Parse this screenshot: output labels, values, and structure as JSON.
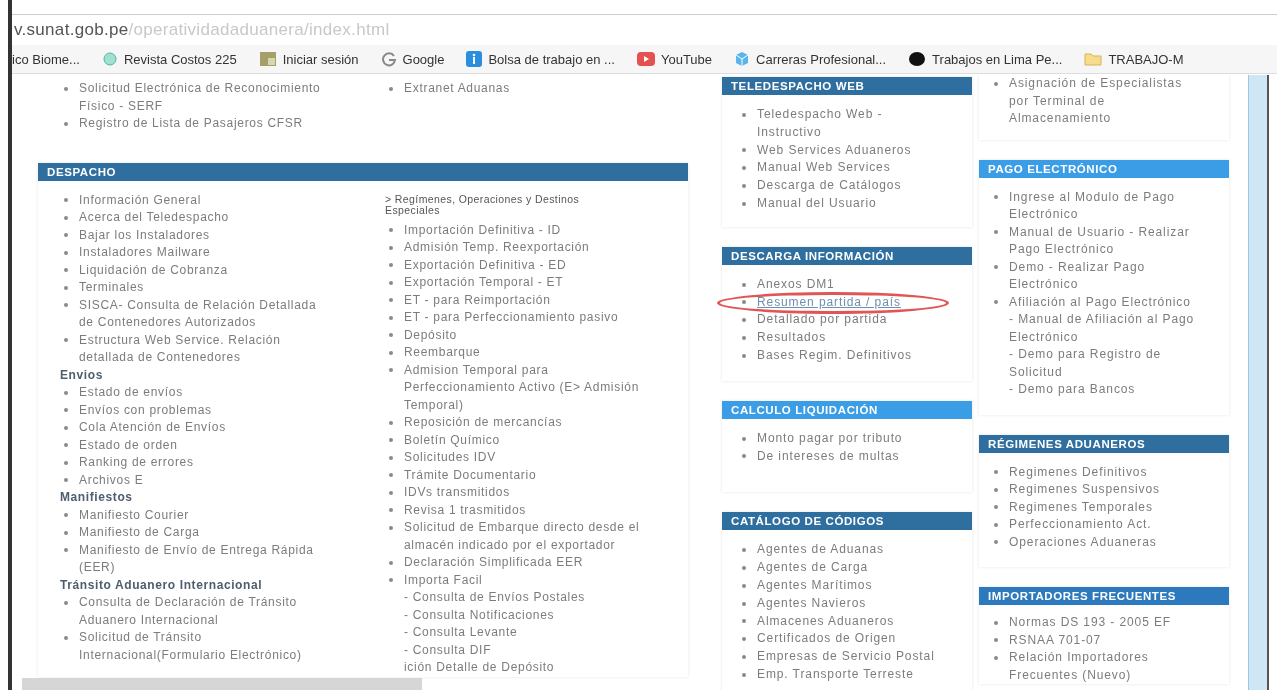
{
  "address_bar": {
    "domain": "v.sunat.gob.pe",
    "path": "/operatividadaduanera/index.html"
  },
  "bookmarks": [
    {
      "label": "ico Biome..."
    },
    {
      "label": "Revista Costos 225"
    },
    {
      "label": "Iniciar sesión"
    },
    {
      "label": "Google"
    },
    {
      "label": "Bolsa de trabajo en ..."
    },
    {
      "label": "YouTube"
    },
    {
      "label": "Carreras Profesional..."
    },
    {
      "label": "Trabajos en Lima Pe..."
    },
    {
      "label": "TRABAJO-M"
    }
  ],
  "left_column": [
    {
      "lists": [
        [
          {
            "kind": "item",
            "text": "Solicitud Electrónica de Reconocimiento Físico - SERF"
          },
          {
            "kind": "item",
            "text": "Registro de Lista de Pasajeros CFSR"
          }
        ],
        [
          {
            "kind": "item",
            "text": "Extranet Aduanas"
          }
        ]
      ]
    },
    {
      "title": "DESPACHO",
      "color": "#2f6f9f",
      "lists": [
        [
          {
            "kind": "item",
            "text": "Información General"
          },
          {
            "kind": "item",
            "text": "Acerca del Teledespacho"
          },
          {
            "kind": "item",
            "text": "Bajar los Instaladores"
          },
          {
            "kind": "item",
            "text": "Instaladores Mailware"
          },
          {
            "kind": "item",
            "text": "Liquidación de Cobranza"
          },
          {
            "kind": "item",
            "text": "Terminales"
          },
          {
            "kind": "item",
            "text": "SISCA- Consulta de Relación Detallada de Contenedores Autorizados"
          },
          {
            "kind": "item",
            "text": "Estructura Web Service. Relación detallada de Contenedores"
          },
          {
            "kind": "heading",
            "text": "Envios"
          },
          {
            "kind": "item",
            "text": "Estado de envíos"
          },
          {
            "kind": "item",
            "text": "Envíos con problemas"
          },
          {
            "kind": "item",
            "text": "Cola Atención de Envíos"
          },
          {
            "kind": "item",
            "text": "Estado de orden"
          },
          {
            "kind": "item",
            "text": "Ranking de errores"
          },
          {
            "kind": "item",
            "text": "Archivos E"
          },
          {
            "kind": "heading",
            "text": "Manifiestos"
          },
          {
            "kind": "item",
            "text": "Manifiesto Courier"
          },
          {
            "kind": "item",
            "text": "Manifiesto de Carga"
          },
          {
            "kind": "item",
            "text": "Manifiesto de Envío de Entrega Rápida (EER)"
          },
          {
            "kind": "heading",
            "text": "Tránsito Aduanero Internacional"
          },
          {
            "kind": "item",
            "text": "Consulta de Declaración de Tránsito Aduanero Internacional"
          },
          {
            "kind": "item",
            "text": "Solicitud de Tránsito Internacional(Formulario Electrónico)"
          }
        ],
        [
          {
            "kind": "note",
            "text": "> Regímenes, Operaciones y Destinos Especiales"
          },
          {
            "kind": "item",
            "text": "Importación Definitiva - ID"
          },
          {
            "kind": "item",
            "text": "Admisión Temp. Reexportación"
          },
          {
            "kind": "item",
            "text": "Exportación Definitiva - ED"
          },
          {
            "kind": "item",
            "text": "Exportación Temporal - ET"
          },
          {
            "kind": "item",
            "text": "ET - para Reimportación"
          },
          {
            "kind": "item",
            "text": "ET - para Perfeccionamiento pasivo"
          },
          {
            "kind": "item",
            "text": "Depósito"
          },
          {
            "kind": "item",
            "text": "Reembarque"
          },
          {
            "kind": "item",
            "text": "Admision Temporal para Perfeccionamiento Activo (E> Admisión Temporal)"
          },
          {
            "kind": "item",
            "text": "Reposición de mercancías"
          },
          {
            "kind": "item",
            "text": "Boletín Químico"
          },
          {
            "kind": "item",
            "text": "Solicitudes IDV"
          },
          {
            "kind": "item",
            "text": "Trámite Documentario"
          },
          {
            "kind": "item",
            "text": "IDVs transmitidos"
          },
          {
            "kind": "item",
            "text": "Revisa 1 trasmitidos"
          },
          {
            "kind": "item",
            "text": "Solicitud de Embarque directo desde el almacén indicado por el exportador"
          },
          {
            "kind": "item",
            "text": "Declaración Simplificada EER"
          },
          {
            "kind": "item",
            "text": "Importa Facil"
          },
          {
            "kind": "subitem",
            "text": "- Consulta de Envíos Postales"
          },
          {
            "kind": "subitem",
            "text": "- Consulta Notificaciones"
          },
          {
            "kind": "subitem",
            "text": "- Consulta Levante"
          },
          {
            "kind": "subitem",
            "text": "- Consulta DIF"
          },
          {
            "kind": "subitem",
            "text": "ición Detalle de Depósito"
          }
        ]
      ]
    }
  ],
  "middle_column": [
    {
      "title": "TELEDESPACHO WEB",
      "color": "#2f6f9f",
      "lists": [
        [
          {
            "kind": "item",
            "text": "Teledespacho Web - Instructivo"
          },
          {
            "kind": "item",
            "text": "Web Services Aduaneros"
          },
          {
            "kind": "item",
            "text": "Manual Web Services"
          },
          {
            "kind": "item",
            "text": "Descarga de Catálogos"
          },
          {
            "kind": "item",
            "text": "Manual del Usuario"
          }
        ]
      ]
    },
    {
      "title": "DESCARGA INFORMACIÓN",
      "color": "#2f6f9f",
      "lists": [
        [
          {
            "kind": "item",
            "text": "Anexos DM1",
            "circled": false
          },
          {
            "kind": "item",
            "text": "Resumen partida / país",
            "circled": true
          },
          {
            "kind": "item",
            "text": "Detallado por partida",
            "circled": false
          },
          {
            "kind": "item",
            "text": "Resultados",
            "circled": false
          },
          {
            "kind": "item",
            "text": "Bases Regim. Definitivos",
            "circled": false
          }
        ]
      ]
    },
    {
      "title": "CALCULO LIQUIDACIÓN",
      "color": "#3a9de6",
      "lists": [
        [
          {
            "kind": "item",
            "text": "Monto pagar por tributo"
          },
          {
            "kind": "item",
            "text": "De intereses de multas"
          }
        ]
      ]
    },
    {
      "title": "CATÁLOGO DE CÓDIGOS",
      "color": "#2f6f9f",
      "lists": [
        [
          {
            "kind": "item",
            "text": "Agentes de Aduanas"
          },
          {
            "kind": "item",
            "text": "Agentes de Carga"
          },
          {
            "kind": "item",
            "text": "Agentes Marítimos"
          },
          {
            "kind": "item",
            "text": "Agentes Navieros"
          },
          {
            "kind": "item",
            "text": "Almacenes Aduaneros"
          },
          {
            "kind": "item",
            "text": "Certificados de Origen"
          },
          {
            "kind": "item",
            "text": "Empresas de Servicio Postal"
          },
          {
            "kind": "item",
            "text": "Emp. Transporte Terreste"
          }
        ]
      ]
    }
  ],
  "right_column": [
    {
      "lists": [
        [
          {
            "kind": "item",
            "text": "Asignación de Especialistas por Terminal de Almacenamiento"
          }
        ]
      ]
    },
    {
      "title": "PAGO ELECTRÓNICO",
      "color": "#3a9de6",
      "lists": [
        [
          {
            "kind": "item",
            "text": "Ingrese al Modulo de Pago Electrónico"
          },
          {
            "kind": "item",
            "text": "Manual de Usuario - Realizar Pago Electrónico"
          },
          {
            "kind": "item",
            "text": "Demo - Realizar Pago Electrónico"
          },
          {
            "kind": "item",
            "text": "Afiliación al Pago Electrónico"
          },
          {
            "kind": "subitem",
            "text": "- Manual de Afiliación al Pago Electrónico"
          },
          {
            "kind": "subitem",
            "text": "- Demo para Registro de Solicitud"
          },
          {
            "kind": "subitem",
            "text": "- Demo para Bancos"
          }
        ]
      ]
    },
    {
      "title": "RÉGIMENES ADUANEROS",
      "color": "#2f6f9f",
      "lists": [
        [
          {
            "kind": "item",
            "text": "Regimenes Definitivos"
          },
          {
            "kind": "item",
            "text": "Regimenes Suspensivos"
          },
          {
            "kind": "item",
            "text": "Regimenes Temporales"
          },
          {
            "kind": "item",
            "text": "Perfeccionamiento Act."
          },
          {
            "kind": "item",
            "text": "Operaciones Aduaneras"
          }
        ]
      ]
    },
    {
      "title": "IMPORTADORES FRECUENTES",
      "color": "#2c79bd",
      "lists": [
        [
          {
            "kind": "item",
            "text": "Normas DS 193 - 2005 EF"
          },
          {
            "kind": "item",
            "text": "RSNAA 701-07"
          },
          {
            "kind": "item",
            "text": "Relación Importadores Frecuentes (Nuevo)"
          }
        ]
      ]
    }
  ]
}
